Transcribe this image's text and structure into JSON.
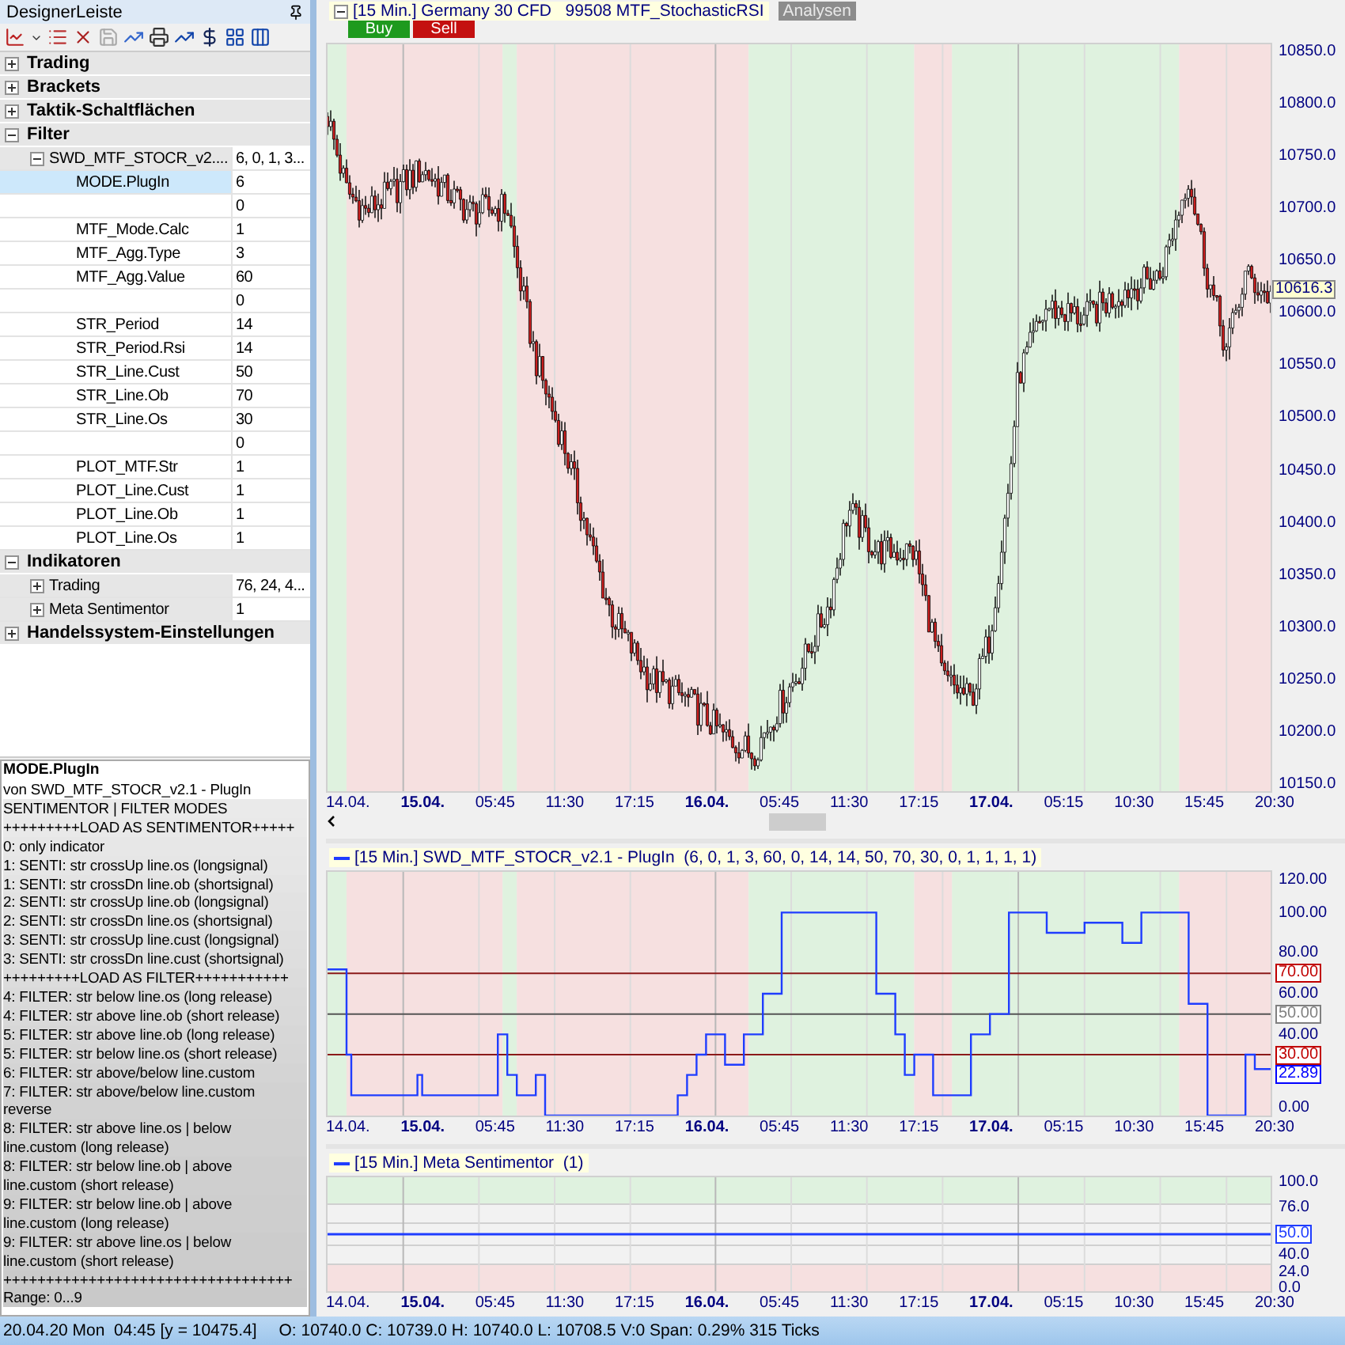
{
  "panel": {
    "title": "DesignerLeiste"
  },
  "tree": [
    {
      "label": "Trading",
      "expanded": false
    },
    {
      "label": "Brackets",
      "expanded": false
    },
    {
      "label": "Taktik-Schaltflächen",
      "expanded": false
    },
    {
      "label": "Filter",
      "expanded": true,
      "children": [
        {
          "name": "SWD_MTF_STOCR_v2....",
          "value": "6, 0, 1, 3...",
          "expanded": true,
          "children": [
            {
              "name": "MODE.PlugIn",
              "value": "6",
              "selected": true
            },
            {
              "value": "0",
              "selected": false
            },
            {
              "name": "MTF_Mode.Calc",
              "value": "1",
              "selected": false
            },
            {
              "name": "MTF_Agg.Type",
              "value": "3",
              "selected": false
            },
            {
              "name": "MTF_Agg.Value",
              "value": "60",
              "selected": false
            },
            {
              "value": "0",
              "selected": false
            },
            {
              "name": "STR_Period",
              "value": "14",
              "selected": false
            },
            {
              "name": "STR_Period.Rsi",
              "value": "14",
              "selected": false
            },
            {
              "name": "STR_Line.Cust",
              "value": "50",
              "selected": false
            },
            {
              "name": "STR_Line.Ob",
              "value": "70",
              "selected": false
            },
            {
              "name": "STR_Line.Os",
              "value": "30",
              "selected": false
            },
            {
              "value": "0",
              "selected": false
            },
            {
              "name": "PLOT_MTF.Str",
              "value": "1",
              "selected": false
            },
            {
              "name": "PLOT_Line.Cust",
              "value": "1",
              "selected": false
            },
            {
              "name": "PLOT_Line.Ob",
              "value": "1",
              "selected": false
            },
            {
              "name": "PLOT_Line.Os",
              "value": "1",
              "selected": false
            }
          ]
        }
      ]
    },
    {
      "label": "Indikatoren",
      "expanded": true,
      "children": [
        {
          "name": "Trading",
          "value": "76, 24, 4...",
          "expanded": false
        },
        {
          "name": "Meta Sentimentor",
          "value": "1",
          "expanded": false
        }
      ]
    },
    {
      "label": "Handelssystem-Einstellungen",
      "expanded": false
    }
  ],
  "description": {
    "title": "MODE.PlugIn",
    "lines": [
      "von SWD_MTF_STOCR_v2.1 - PlugIn",
      "SENTIMENTOR | FILTER MODES",
      "+++++++++LOAD AS SENTIMENTOR+++++",
      "0: only indicator",
      "1: SENTI: str crossUp line.os (longsignal)",
      "1: SENTI: str crossDn line.ob (shortsignal)",
      "2: SENTI: str crossUp line.ob (longsignal)",
      "2: SENTI: str crossDn line.os (shortsignal)",
      "3: SENTI: str crossUp line.cust (longsignal)",
      "3: SENTI: str crossDn line.cust (shortsignal)",
      "+++++++++LOAD AS FILTER+++++++++++",
      "4: FILTER: str below line.os (long release)",
      "4: FILTER: str above line.ob (short release)",
      "5: FILTER: str above line.ob (long release)",
      "5: FILTER: str below line.os (short release)",
      "6: FILTER: str above/below line.custom",
      "7: FILTER: str above/below line.custom reverse",
      "8: FILTER: str above line.os | below line.custom (long release)",
      "8: FILTER: str below line.ob | above line.custom (short release)",
      "9: FILTER: str below line.ob | above line.custom (long release)",
      "9: FILTER: str above line.os | below line.custom (short release)",
      "++++++++++++++++++++++++++++++++++",
      "Range: 0...9"
    ]
  },
  "chart": {
    "title": "[15 Min.] Germany 30 CFD",
    "instrument": "99508 MTF_StochasticRSI",
    "badge": "Analysen",
    "expanded": true,
    "buttons": [
      {
        "label": "Buy",
        "kind": "buy"
      },
      {
        "label": "Sell",
        "kind": "sell"
      }
    ],
    "price_axis": [
      "10850.0",
      "10800.0",
      "10750.0",
      "10700.0",
      "10650.0",
      "10600.0",
      "10550.0",
      "10500.0",
      "10450.0",
      "10400.0",
      "10350.0",
      "10300.0",
      "10250.0",
      "10200.0",
      "10150.0"
    ],
    "price_tag": "10616.3",
    "time_axis": [
      {
        "text": "14.04.",
        "bold": false
      },
      {
        "text": "15.04.",
        "bold": true
      },
      {
        "text": "05:45",
        "bold": false
      },
      {
        "text": "11:30",
        "bold": false
      },
      {
        "text": "17:15",
        "bold": false
      },
      {
        "text": "16.04.",
        "bold": true
      },
      {
        "text": "05:45",
        "bold": false
      },
      {
        "text": "11:30",
        "bold": false
      },
      {
        "text": "17:15",
        "bold": false
      },
      {
        "text": "17.04.",
        "bold": true
      },
      {
        "text": "05:15",
        "bold": false
      },
      {
        "text": "10:30",
        "bold": false
      },
      {
        "text": "15:45",
        "bold": false
      },
      {
        "text": "20:30",
        "bold": false
      }
    ]
  },
  "oscillator": {
    "legend": "[15 Min.] SWD_MTF_STOCR_v2.1 - PlugIn  (6, 0, 1, 3, 60, 0, 14, 14, 50, 70, 30, 0, 1, 1, 1, 1)",
    "axis": [
      "120.00",
      "100.00",
      "80.00",
      "60.00",
      "40.00",
      "0.00"
    ],
    "tags": [
      {
        "text": "70.00",
        "color": "#c00000"
      },
      {
        "text": "50.00",
        "color": "#808080"
      },
      {
        "text": "30.00",
        "color": "#c00000"
      },
      {
        "text": "22.89",
        "color": "#0000ff"
      }
    ],
    "time_axis": [
      {
        "text": "14.04.",
        "bold": false
      },
      {
        "text": "15.04.",
        "bold": true
      },
      {
        "text": "05:45",
        "bold": false
      },
      {
        "text": "11:30",
        "bold": false
      },
      {
        "text": "17:15",
        "bold": false
      },
      {
        "text": "16.04.",
        "bold": true
      },
      {
        "text": "05:45",
        "bold": false
      },
      {
        "text": "11:30",
        "bold": false
      },
      {
        "text": "17:15",
        "bold": false
      },
      {
        "text": "17.04.",
        "bold": true
      },
      {
        "text": "05:15",
        "bold": false
      },
      {
        "text": "10:30",
        "bold": false
      },
      {
        "text": "15:45",
        "bold": false
      },
      {
        "text": "20:30",
        "bold": false
      }
    ]
  },
  "sentimentor": {
    "legend": "[15 Min.] Meta Sentimentor  (1)",
    "axis": [
      "100.0",
      "76.0",
      "40.0",
      "24.0",
      "0.0"
    ],
    "tag": "50.0",
    "time_axis": [
      {
        "text": "14.04.",
        "bold": false
      },
      {
        "text": "15.04.",
        "bold": true
      },
      {
        "text": "05:45",
        "bold": false
      },
      {
        "text": "11:30",
        "bold": false
      },
      {
        "text": "17:15",
        "bold": false
      },
      {
        "text": "16.04.",
        "bold": true
      },
      {
        "text": "05:45",
        "bold": false
      },
      {
        "text": "11:30",
        "bold": false
      },
      {
        "text": "17:15",
        "bold": false
      },
      {
        "text": "17.04.",
        "bold": true
      },
      {
        "text": "05:15",
        "bold": false
      },
      {
        "text": "10:30",
        "bold": false
      },
      {
        "text": "15:45",
        "bold": false
      },
      {
        "text": "20:30",
        "bold": false
      }
    ]
  },
  "status_bar": {
    "position": "20.04.20 Mon  04:45 [y = 10475.4]",
    "ohlc": "O: 10740.0 C: 10739.0 H: 10740.0 L: 10708.5 V:0 Span: 0.29% 315 Ticks"
  }
}
